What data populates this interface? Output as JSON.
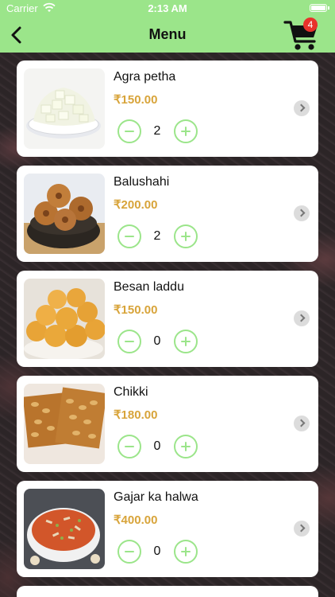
{
  "status_bar": {
    "carrier": "Carrier",
    "time": "2:13 AM"
  },
  "nav": {
    "title": "Menu",
    "cart_count": "4"
  },
  "items": [
    {
      "name": "Agra petha",
      "price": "₹150.00",
      "qty": "2"
    },
    {
      "name": "Balushahi",
      "price": "₹200.00",
      "qty": "2"
    },
    {
      "name": "Besan laddu",
      "price": "₹150.00",
      "qty": "0"
    },
    {
      "name": "Chikki",
      "price": "₹180.00",
      "qty": "0"
    },
    {
      "name": "Gajar ka halwa",
      "price": "₹400.00",
      "qty": "0"
    }
  ],
  "colors": {
    "accent": "#9be58a",
    "price": "#d8a43a",
    "badge": "#e8322b"
  }
}
